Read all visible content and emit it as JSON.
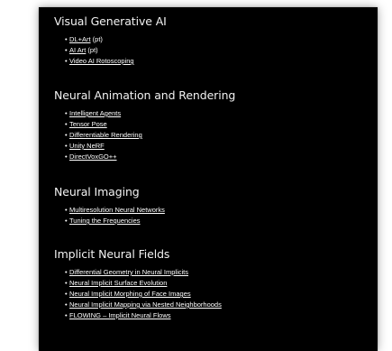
{
  "sections": [
    {
      "title": "Visual Generative AI",
      "items": [
        {
          "label": "DL+Art",
          "suffix": " (pt)"
        },
        {
          "label": "AI Art",
          "suffix": " (pt)"
        },
        {
          "label": "Video AI Rotoscoping",
          "suffix": ""
        }
      ]
    },
    {
      "title": "Neural Animation and Rendering",
      "items": [
        {
          "label": "Intelligent Agents",
          "suffix": ""
        },
        {
          "label": "Tensor Pose",
          "suffix": ""
        },
        {
          "label": "Differentiable Rendering",
          "suffix": ""
        },
        {
          "label": "Unity NeRF",
          "suffix": ""
        },
        {
          "label": "DirectVoxGO++",
          "suffix": ""
        }
      ]
    },
    {
      "title": "Neural Imaging",
      "items": [
        {
          "label": "Multiresolution Neural Networks",
          "suffix": ""
        },
        {
          "label": "Tuning the Frequencies",
          "suffix": ""
        }
      ]
    },
    {
      "title": "Implicit Neural Fields",
      "items": [
        {
          "label": "Differential Geometry in Neural Implicits",
          "suffix": ""
        },
        {
          "label": "Neural Implicit Surface Evolution",
          "suffix": ""
        },
        {
          "label": "Neural Implicit Morphing of Face Images",
          "suffix": ""
        },
        {
          "label": "Neural Implicit Mapping via Nested Neighborhoods",
          "suffix": ""
        },
        {
          "label": "FLOWING – Implicit Neural Flows",
          "suffix": ""
        }
      ]
    }
  ],
  "bullet": "•",
  "colors": {
    "background": "#000000",
    "text": "#ffffff"
  }
}
